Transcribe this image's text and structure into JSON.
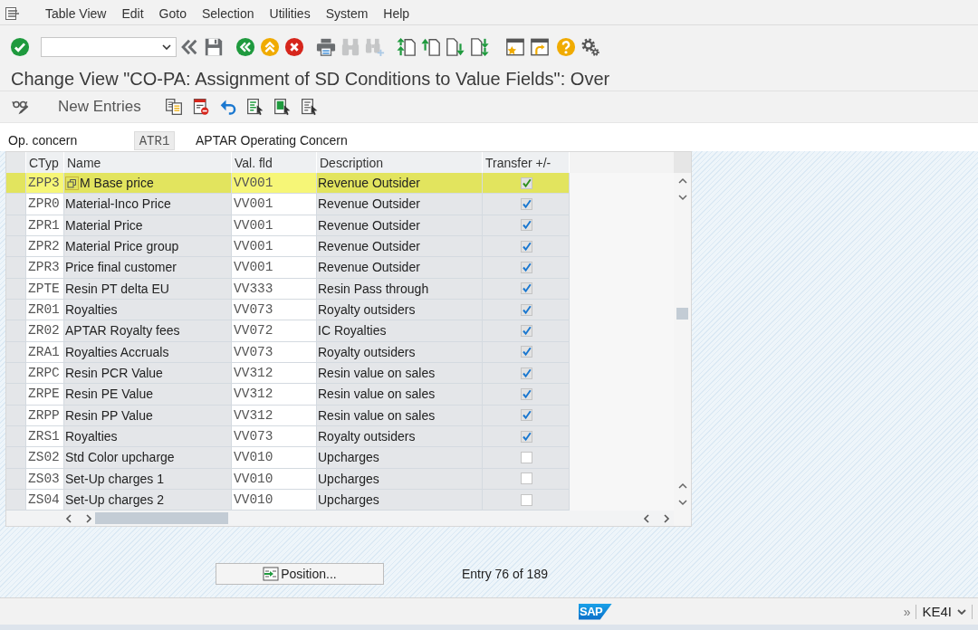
{
  "menu_bar": {
    "items": [
      "Table View",
      "Edit",
      "Goto",
      "Selection",
      "Utilities",
      "System",
      "Help"
    ]
  },
  "toolbar": [
    {
      "kind": "enter",
      "disabled": false
    },
    {
      "kind": "command-field",
      "disabled": false
    },
    {
      "kind": "collapse",
      "disabled": false
    },
    {
      "kind": "save",
      "disabled": false
    },
    {
      "kind": "back",
      "disabled": false
    },
    {
      "kind": "exit",
      "disabled": false
    },
    {
      "kind": "cancel",
      "disabled": false
    },
    {
      "kind": "print",
      "disabled": false
    },
    {
      "kind": "find",
      "disabled": true
    },
    {
      "kind": "find-next",
      "disabled": true
    },
    {
      "kind": "first-page",
      "disabled": false
    },
    {
      "kind": "previous-page",
      "disabled": false
    },
    {
      "kind": "next-page",
      "disabled": false
    },
    {
      "kind": "last-page",
      "disabled": false
    },
    {
      "kind": "new-session",
      "disabled": false
    },
    {
      "kind": "shortcut",
      "disabled": false
    },
    {
      "kind": "help",
      "disabled": false
    },
    {
      "kind": "settings",
      "disabled": false
    }
  ],
  "title": "Change View \"CO-PA: Assignment of SD Conditions to Value Fields\": Over",
  "app_toolbar": {
    "new_entries": "New Entries"
  },
  "header_field": {
    "label": "Op. concern",
    "value": "ATR1",
    "description": "APTAR Operating Concern"
  },
  "table": {
    "columns": [
      "CTyp",
      "Name",
      "Val. fld",
      "Description",
      "Transfer +/-"
    ],
    "rows": [
      {
        "ctyp": "ZPP3",
        "name": "M Base price",
        "val_fld": "VV001",
        "description": "Revenue Outsider",
        "transfer": true,
        "highlighted": true,
        "focused": true
      },
      {
        "ctyp": "ZPR0",
        "name": "Material-Inco Price",
        "val_fld": "VV001",
        "description": "Revenue Outsider",
        "transfer": true,
        "highlighted": false,
        "focused": false
      },
      {
        "ctyp": "ZPR1",
        "name": "Material Price",
        "val_fld": "VV001",
        "description": "Revenue Outsider",
        "transfer": true,
        "highlighted": false,
        "focused": false
      },
      {
        "ctyp": "ZPR2",
        "name": "Material Price group",
        "val_fld": "VV001",
        "description": "Revenue Outsider",
        "transfer": true,
        "highlighted": false,
        "focused": false
      },
      {
        "ctyp": "ZPR3",
        "name": "Price final customer",
        "val_fld": "VV001",
        "description": "Revenue Outsider",
        "transfer": true,
        "highlighted": false,
        "focused": false
      },
      {
        "ctyp": "ZPTE",
        "name": "Resin PT delta EU",
        "val_fld": "VV333",
        "description": "Resin Pass through",
        "transfer": true,
        "highlighted": false,
        "focused": false
      },
      {
        "ctyp": "ZR01",
        "name": "Royalties",
        "val_fld": "VV073",
        "description": "Royalty outsiders",
        "transfer": true,
        "highlighted": false,
        "focused": false
      },
      {
        "ctyp": "ZR02",
        "name": "APTAR Royalty fees",
        "val_fld": "VV072",
        "description": "IC Royalties",
        "transfer": true,
        "highlighted": false,
        "focused": false
      },
      {
        "ctyp": "ZRA1",
        "name": "Royalties Accruals",
        "val_fld": "VV073",
        "description": "Royalty outsiders",
        "transfer": true,
        "highlighted": false,
        "focused": false
      },
      {
        "ctyp": "ZRPC",
        "name": "Resin PCR Value",
        "val_fld": "VV312",
        "description": "Resin value on sales",
        "transfer": true,
        "highlighted": false,
        "focused": false
      },
      {
        "ctyp": "ZRPE",
        "name": "Resin PE Value",
        "val_fld": "VV312",
        "description": "Resin value on sales",
        "transfer": true,
        "highlighted": false,
        "focused": false
      },
      {
        "ctyp": "ZRPP",
        "name": "Resin PP Value",
        "val_fld": "VV312",
        "description": "Resin value on sales",
        "transfer": true,
        "highlighted": false,
        "focused": false
      },
      {
        "ctyp": "ZRS1",
        "name": "Royalties",
        "val_fld": "VV073",
        "description": "Royalty outsiders",
        "transfer": true,
        "highlighted": false,
        "focused": false
      },
      {
        "ctyp": "ZS02",
        "name": "Std Color upcharge",
        "val_fld": "VV010",
        "description": "Upcharges",
        "transfer": false,
        "highlighted": false,
        "focused": false
      },
      {
        "ctyp": "ZS03",
        "name": "Set-Up charges 1",
        "val_fld": "VV010",
        "description": "Upcharges",
        "transfer": false,
        "highlighted": false,
        "focused": false
      },
      {
        "ctyp": "ZS04",
        "name": "Set-Up charges 2",
        "val_fld": "VV010",
        "description": "Upcharges",
        "transfer": false,
        "highlighted": false,
        "focused": false
      }
    ]
  },
  "position_button": "Position...",
  "entry_info": "Entry 76 of 189",
  "status_bar": {
    "logo": "SAP",
    "expand": "»",
    "transaction": "KE4I"
  }
}
